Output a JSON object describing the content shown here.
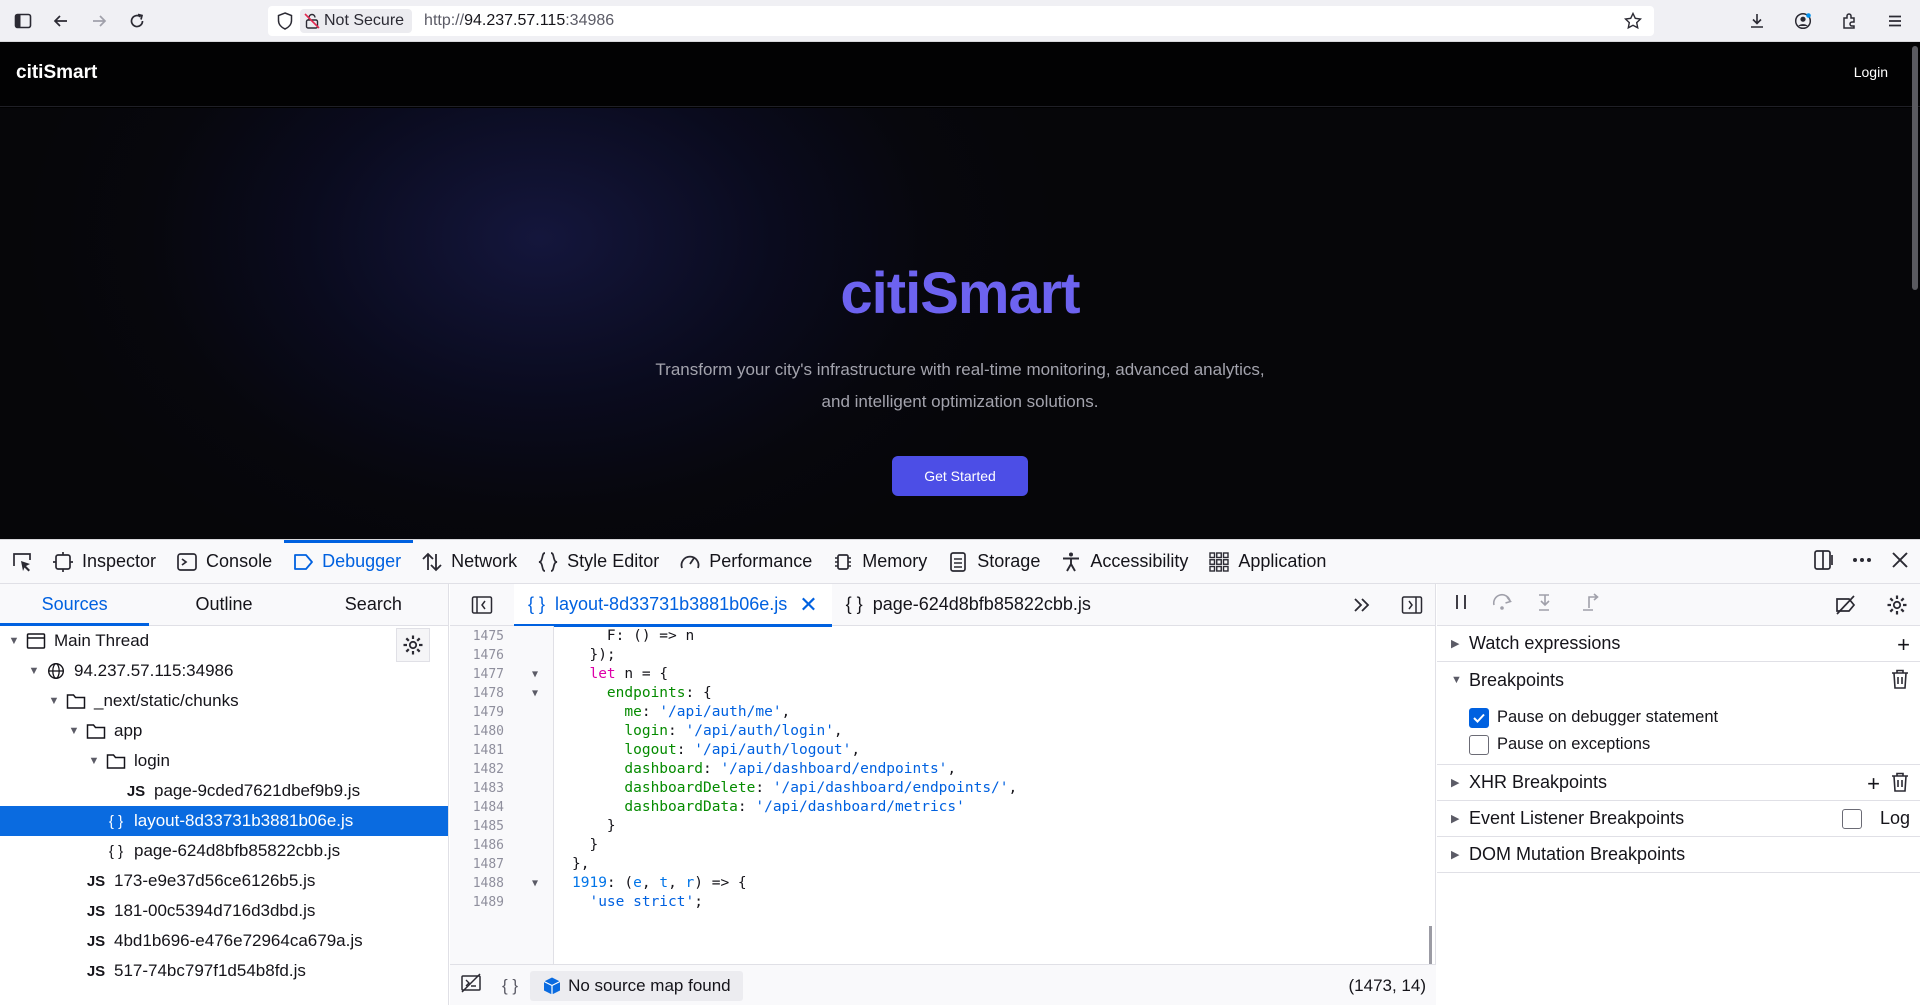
{
  "browser": {
    "not_secure_label": "Not Secure",
    "url_prefix": "http://",
    "url_host": "94.237.57.115",
    "url_port": ":34986"
  },
  "site": {
    "logo": "citiSmart",
    "login": "Login",
    "hero_title": "citiSmart",
    "hero_line1": "Transform your city's infrastructure with real-time monitoring, advanced analytics,",
    "hero_line2": "and intelligent optimization solutions.",
    "cta": "Get Started"
  },
  "devtools": {
    "tabs": [
      "Inspector",
      "Console",
      "Debugger",
      "Network",
      "Style Editor",
      "Performance",
      "Memory",
      "Storage",
      "Accessibility",
      "Application"
    ],
    "active_tab": "Debugger",
    "source_tabs": [
      "Sources",
      "Outline",
      "Search"
    ],
    "tree": [
      {
        "label": "Main Thread",
        "depth": 0,
        "icon": "window",
        "twisty": "open"
      },
      {
        "label": "94.237.57.115:34986",
        "depth": 1,
        "icon": "globe",
        "twisty": "open"
      },
      {
        "label": "_next/static/chunks",
        "depth": 2,
        "icon": "folder",
        "twisty": "open"
      },
      {
        "label": "app",
        "depth": 3,
        "icon": "folder",
        "twisty": "open"
      },
      {
        "label": "login",
        "depth": 4,
        "icon": "folder",
        "twisty": "open"
      },
      {
        "label": "page-9cded7621dbef9b9.js",
        "depth": 5,
        "icon": "js"
      },
      {
        "label": "layout-8d33731b3881b06e.js",
        "depth": 4,
        "icon": "braces",
        "selected": true
      },
      {
        "label": "page-624d8bfb85822cbb.js",
        "depth": 4,
        "icon": "braces"
      },
      {
        "label": "173-e9e37d56ce6126b5.js",
        "depth": 3,
        "icon": "js"
      },
      {
        "label": "181-00c5394d716d3dbd.js",
        "depth": 3,
        "icon": "js"
      },
      {
        "label": "4bd1b696-e476e72964ca679a.js",
        "depth": 3,
        "icon": "js"
      },
      {
        "label": "517-74bc797f1d54b8fd.js",
        "depth": 3,
        "icon": "js"
      }
    ],
    "editor_tabs": [
      {
        "label": "layout-8d33731b3881b06e.js",
        "active": true
      },
      {
        "label": "page-624d8bfb85822cbb.js",
        "active": false
      }
    ],
    "code_lines": [
      {
        "n": "1475",
        "fold": "",
        "html": "    F: () => n"
      },
      {
        "n": "1476",
        "fold": "",
        "html": "  });"
      },
      {
        "n": "1477",
        "fold": "▼",
        "html": "  <span class=\"kw\">let</span> n = {"
      },
      {
        "n": "1478",
        "fold": "▼",
        "html": "    <span class=\"pr\">endpoints</span>: {"
      },
      {
        "n": "1479",
        "fold": "",
        "html": "      <span class=\"pr\">me</span>: <span class=\"str\">'/api/auth/me'</span>,"
      },
      {
        "n": "1480",
        "fold": "",
        "html": "      <span class=\"pr\">login</span>: <span class=\"str\">'/api/auth/login'</span>,"
      },
      {
        "n": "1481",
        "fold": "",
        "html": "      <span class=\"pr\">logout</span>: <span class=\"str\">'/api/auth/logout'</span>,"
      },
      {
        "n": "1482",
        "fold": "",
        "html": "      <span class=\"pr\">dashboard</span>: <span class=\"str\">'/api/dashboard/endpoints'</span>,"
      },
      {
        "n": "1483",
        "fold": "",
        "html": "      <span class=\"pr\">dashboardDelete</span>: <span class=\"str\">'/api/dashboard/endpoints/'</span>,"
      },
      {
        "n": "1484",
        "fold": "",
        "html": "      <span class=\"pr\">dashboardData</span>: <span class=\"str\">'/api/dashboard/metrics'</span>"
      },
      {
        "n": "1485",
        "fold": "",
        "html": "    }"
      },
      {
        "n": "1486",
        "fold": "",
        "html": "  }"
      },
      {
        "n": "1487",
        "fold": "",
        "html": "},"
      },
      {
        "n": "1488",
        "fold": "▼",
        "html": "<span class=\"nm\">1919</span>: (<span class=\"nm\">e</span>, <span class=\"nm\">t</span>, <span class=\"nm\">r</span>) => {"
      },
      {
        "n": "1489",
        "fold": "",
        "html": "  <span class=\"str\">'use strict'</span>;"
      }
    ],
    "status_source_map": "No source map found",
    "cursor_position": "(1473, 14)",
    "panes": {
      "watch": "Watch expressions",
      "breakpoints": "Breakpoints",
      "pause_debugger": "Pause on debugger statement",
      "pause_exceptions": "Pause on exceptions",
      "xhr": "XHR Breakpoints",
      "event_listener": "Event Listener Breakpoints",
      "log": "Log",
      "dom_mutation": "DOM Mutation Breakpoints"
    }
  }
}
